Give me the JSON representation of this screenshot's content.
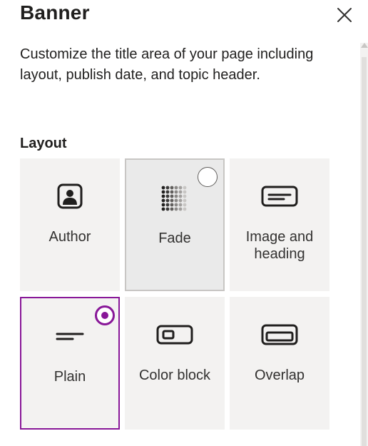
{
  "panel": {
    "title": "Banner",
    "description": "Customize the title area of your page including layout, publish date, and topic header.",
    "close_icon": "close-icon"
  },
  "layout": {
    "heading": "Layout",
    "selected": "Plain",
    "options": [
      {
        "label": "Author",
        "icon": "author-icon"
      },
      {
        "label": "Fade",
        "icon": "fade-icon"
      },
      {
        "label": "Image and heading",
        "icon": "image-heading-icon"
      },
      {
        "label": "Plain",
        "icon": "plain-icon"
      },
      {
        "label": "Color block",
        "icon": "color-block-icon"
      },
      {
        "label": "Overlap",
        "icon": "overlap-icon"
      }
    ]
  },
  "colors": {
    "accent": "#881798",
    "tile_background": "#f3f2f1",
    "text": "#201f1e"
  }
}
